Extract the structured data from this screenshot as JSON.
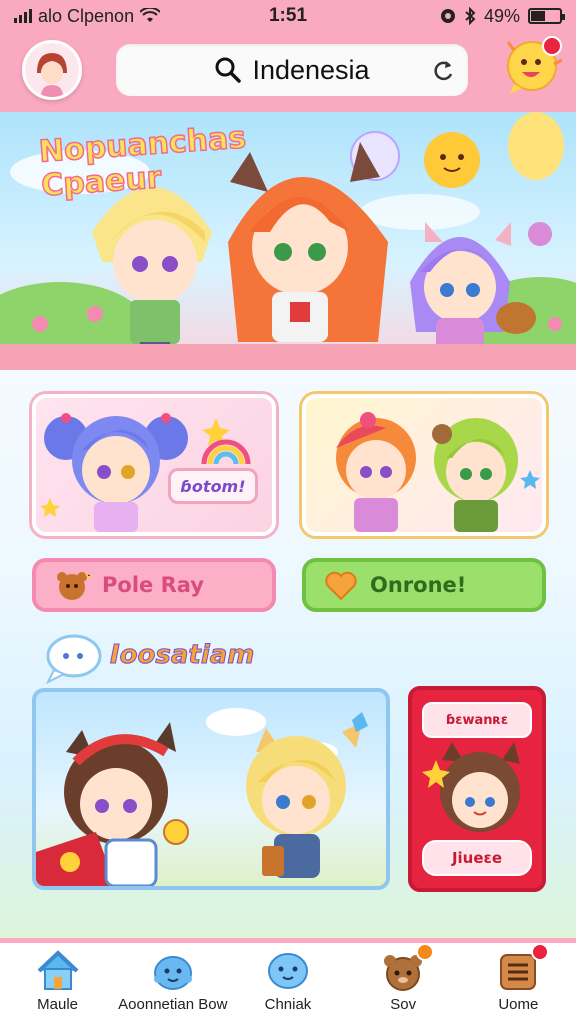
{
  "status_bar": {
    "carrier": "alo Clpenon",
    "time": "1:51",
    "battery": "49%",
    "battery_level": 0.49
  },
  "header": {
    "search_text": "Indenesia"
  },
  "banner": {
    "title": "Nopuanchas Cpaeur"
  },
  "cards": {
    "left_label": "ɓotom!"
  },
  "buttons": {
    "left": "Pole Ray",
    "right": "Onrone!"
  },
  "section": {
    "title": "Ioosatiam"
  },
  "promo": {
    "top_text": "ɓɛwanʀɛ",
    "bottom_text": "Jiueɛe"
  },
  "nav": {
    "items": [
      {
        "label": "Maule",
        "icon": "house-icon"
      },
      {
        "label": "Aoonnetian Bow",
        "icon": "blob-icon"
      },
      {
        "label": "Chniak",
        "icon": "chat-blob-icon"
      },
      {
        "label": "Sov",
        "icon": "bear-icon"
      },
      {
        "label": "Uome",
        "icon": "menu-list-icon"
      }
    ]
  },
  "colors": {
    "header_pink": "#f9a9c0",
    "accent_red": "#e7243f",
    "green": "#9be06a"
  }
}
